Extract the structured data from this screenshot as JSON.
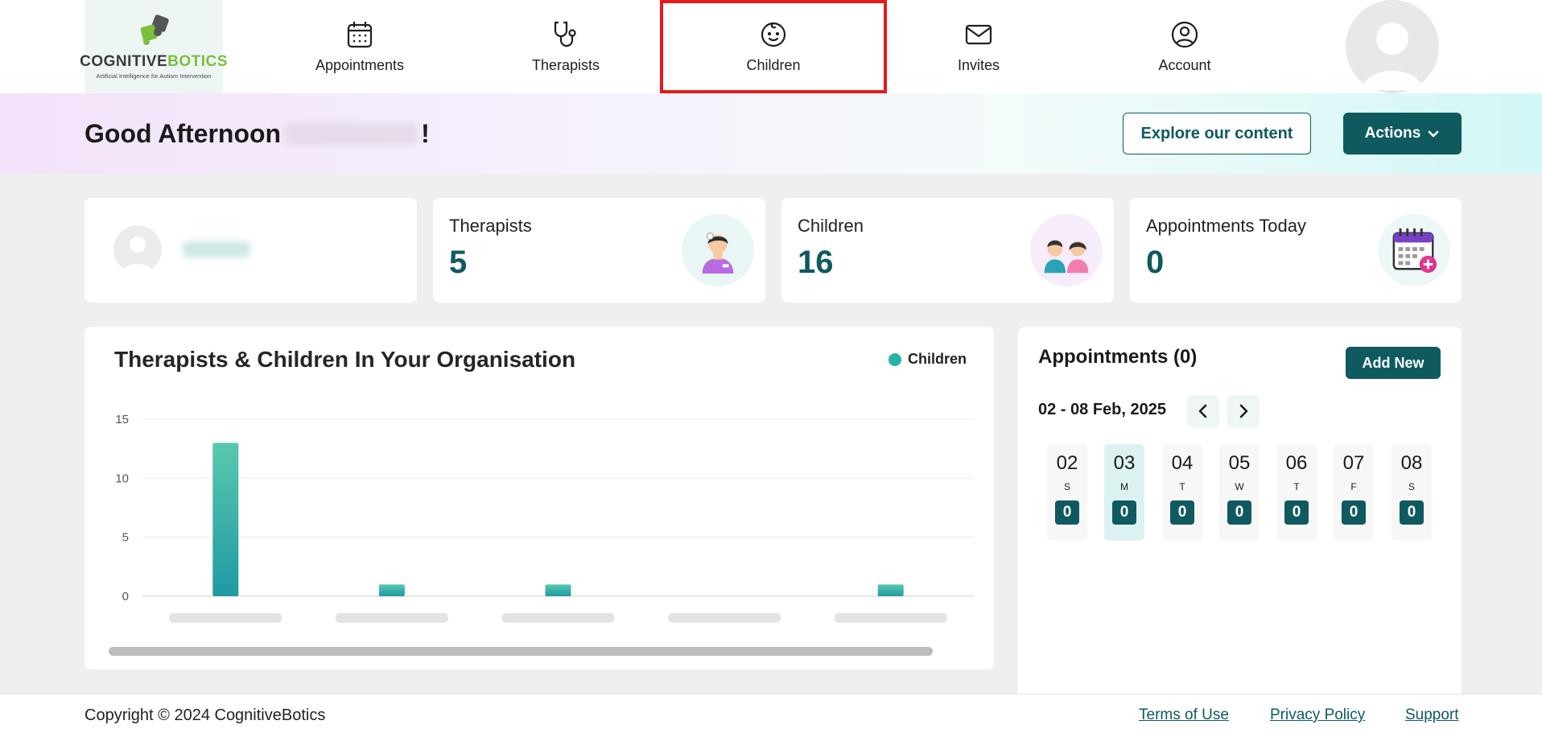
{
  "nav": {
    "logo": {
      "brand_a": "COGNITIVE",
      "brand_b": "BOTICS",
      "tagline": "Artificial Intelligence for Autism Intervention"
    },
    "items": [
      {
        "label": "Appointments",
        "icon": "calendar-icon"
      },
      {
        "label": "Therapists",
        "icon": "stethoscope-icon"
      },
      {
        "label": "Children",
        "icon": "baby-face-icon"
      },
      {
        "label": "Invites",
        "icon": "envelope-icon"
      },
      {
        "label": "Account",
        "icon": "user-circle-icon"
      }
    ],
    "active": "Children"
  },
  "banner": {
    "greeting": "Good Afternoon",
    "punct": "!",
    "explore_label": "Explore our content",
    "actions_label": "Actions"
  },
  "stats": {
    "therapists": {
      "label": "Therapists",
      "value": "5"
    },
    "children": {
      "label": "Children",
      "value": "16"
    },
    "appointments_today": {
      "label": "Appointments Today",
      "value": "0"
    }
  },
  "chart": {
    "title": "Therapists & Children In Your Organisation",
    "legend": "Children"
  },
  "chart_data": {
    "type": "bar",
    "title": "Therapists & Children In Your Organisation",
    "categories": [
      "",
      "",
      "",
      "",
      ""
    ],
    "series": [
      {
        "name": "Children",
        "values": [
          13,
          1,
          1,
          0,
          1
        ]
      }
    ],
    "ylim": [
      0,
      15
    ],
    "yticks": [
      "0",
      "5",
      "10",
      "15"
    ],
    "legend": "top-right",
    "grid": true,
    "colors": {
      "bar_top": "#5ac8ae",
      "bar_bottom": "#1e9aa3"
    }
  },
  "appointments": {
    "title": "Appointments (0)",
    "add_label": "Add New",
    "range": "02 - 08 Feb, 2025",
    "days": [
      {
        "num": "02",
        "wd": "S",
        "count": "0"
      },
      {
        "num": "03",
        "wd": "M",
        "count": "0"
      },
      {
        "num": "04",
        "wd": "T",
        "count": "0"
      },
      {
        "num": "05",
        "wd": "W",
        "count": "0"
      },
      {
        "num": "06",
        "wd": "T",
        "count": "0"
      },
      {
        "num": "07",
        "wd": "F",
        "count": "0"
      },
      {
        "num": "08",
        "wd": "S",
        "count": "0"
      }
    ],
    "selected_day": "03"
  },
  "footer": {
    "copyright": "Copyright © 2024 CognitiveBotics",
    "terms": "Terms of Use",
    "privacy": "Privacy Policy",
    "support": "Support"
  },
  "colors": {
    "primary": "#0f5a5f",
    "accent_green": "#7bbf3c",
    "active_outline": "#e31b1b"
  }
}
